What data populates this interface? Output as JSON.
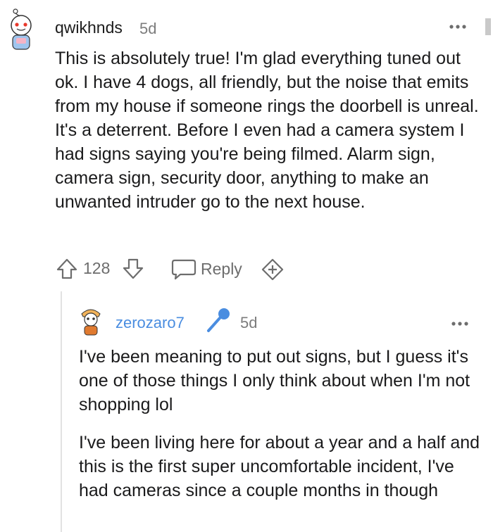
{
  "comment": {
    "username": "qwikhnds",
    "age": "5d",
    "body": "This is absolutely true! I'm glad everything tuned out ok. I have 4 dogs, all friendly, but the noise that emits from my house if someone rings the doorbell is unreal. It's a deterrent. Before I even had a camera system I had signs saying you're being filmed. Alarm sign, camera sign, security door, anything to make an unwanted intruder go to the next house.",
    "votes": "128",
    "reply_label": "Reply"
  },
  "reply": {
    "username": "zerozaro7",
    "age": "5d",
    "paragraphs": [
      "I've been meaning to put out signs, but I guess it's one of those things I only think about when I'm not shopping lol",
      "I've been living here for about a year and a half and this is the first super uncomfortable incident, I've had cameras since a couple months in though"
    ]
  },
  "colors": {
    "username_reply": "#4a8de0",
    "meta": "#7c7c7c",
    "icon": "#6d6d6d",
    "mic": "#4a8de0"
  },
  "icons": [
    "snoo-avatar-icon",
    "more-options-icon",
    "upvote-icon",
    "downvote-icon",
    "reply-bubble-icon",
    "award-plus-icon",
    "snoo-avatar-icon",
    "microphone-icon"
  ]
}
